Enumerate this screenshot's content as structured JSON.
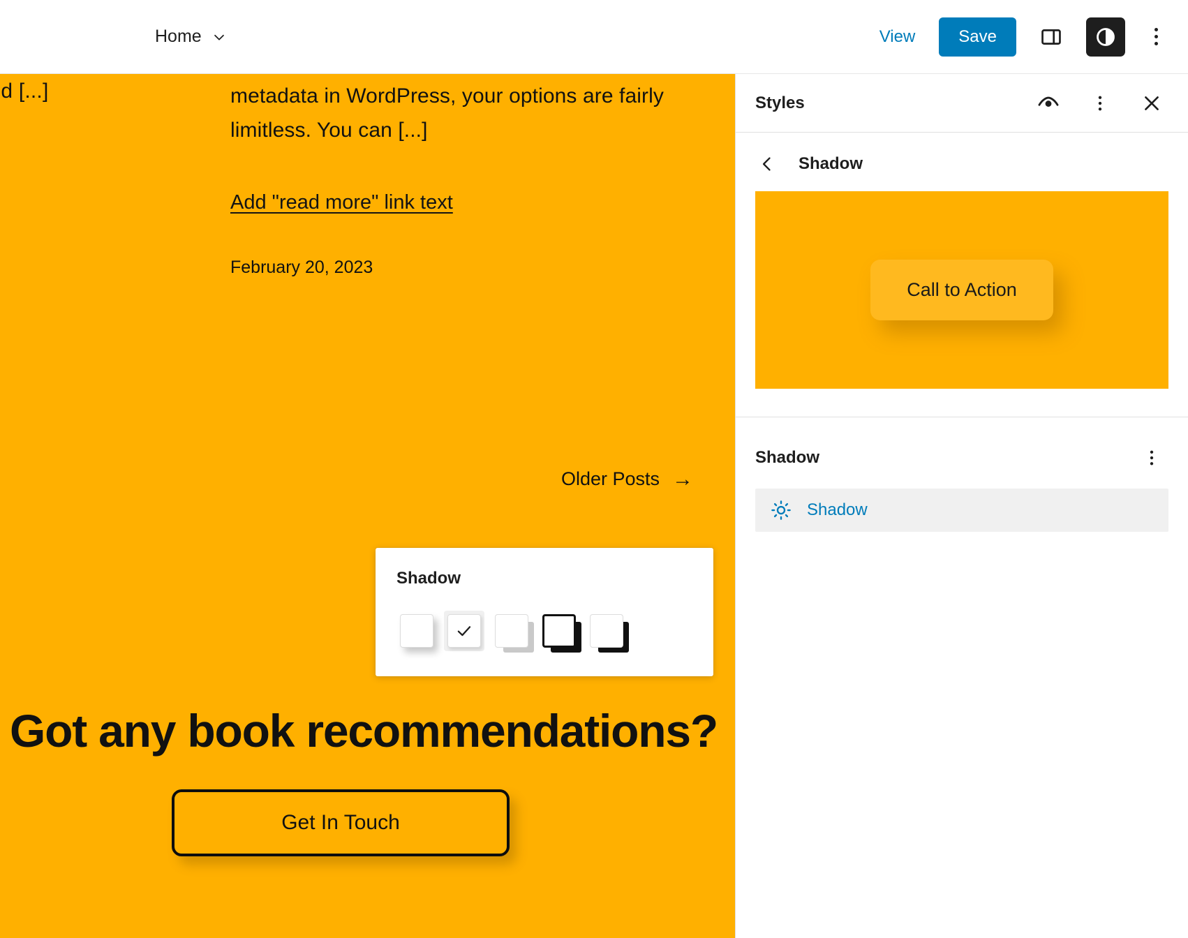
{
  "topbar": {
    "document_title": "Home",
    "view_label": "View",
    "save_label": "Save",
    "icons": {
      "chevron_down": "chevron-down-icon",
      "sidebar_toggle": "sidebar-toggle-icon",
      "styles_contrast": "contrast-icon",
      "more_menu": "kebab-menu-icon"
    }
  },
  "canvas": {
    "background_color": "#ffb000",
    "excerpt_left_fragment": "ıld [...]",
    "excerpt_text": "metadata in WordPress, your options are fairly limitless. You can [...]",
    "read_more_label": "Add \"read more\" link text",
    "post_date": "February 20, 2023",
    "older_posts_label": "Older Posts",
    "older_posts_arrow": "→",
    "cta_heading": "Got any book recommendations?",
    "cta_button_label": "Get In Touch"
  },
  "shadow_popover": {
    "title": "Shadow",
    "swatches": [
      {
        "name": "natural",
        "selected": false
      },
      {
        "name": "selected-soft",
        "selected": true
      },
      {
        "name": "deep-gray",
        "selected": false
      },
      {
        "name": "sharp-outline",
        "selected": false
      },
      {
        "name": "solid-black",
        "selected": false
      }
    ],
    "selected_index": 1
  },
  "sidebar": {
    "header": {
      "title": "Styles",
      "eye_icon": "eye-icon",
      "menu_icon": "kebab-menu-icon",
      "close_icon": "close-icon"
    },
    "nav": {
      "back_icon": "chevron-left-icon",
      "title": "Shadow"
    },
    "preview": {
      "button_label": "Call to Action",
      "background_color": "#ffb000"
    },
    "section": {
      "title": "Shadow",
      "menu_icon": "kebab-menu-icon",
      "items": [
        {
          "label": "Shadow",
          "icon": "shadow-sun-icon"
        }
      ]
    }
  },
  "colors": {
    "accent_blue": "#007cba",
    "canvas_orange": "#ffb000",
    "ink": "#1e1e1e",
    "panel_grey": "#f0f0f0"
  }
}
